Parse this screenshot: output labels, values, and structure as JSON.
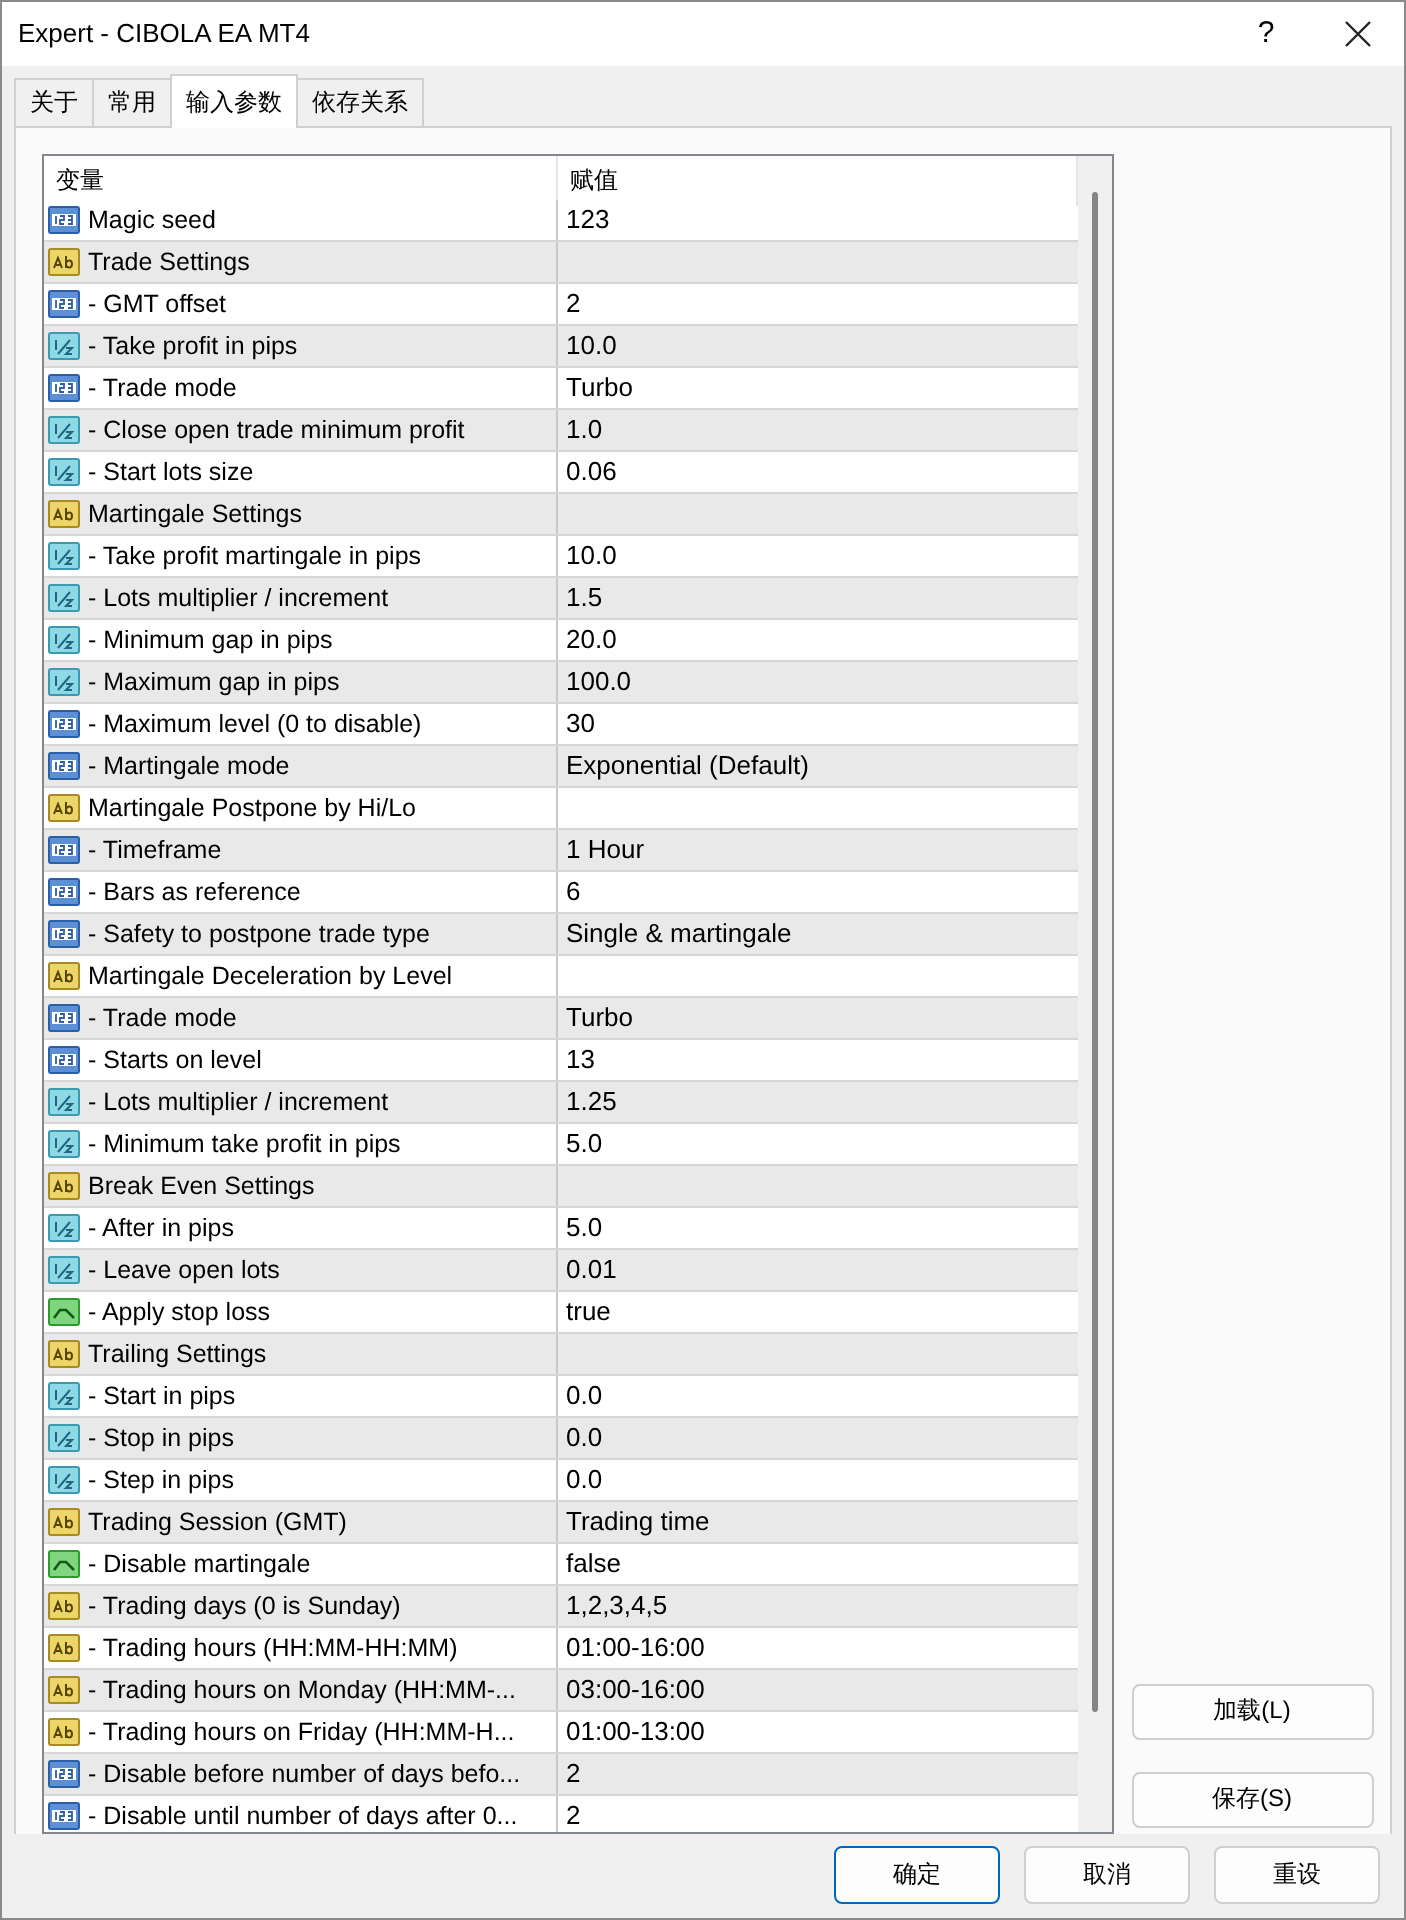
{
  "window": {
    "title": "Expert - CIBOLA EA MT4",
    "help": "?"
  },
  "tabs": [
    {
      "label": "关于",
      "selected": false
    },
    {
      "label": "常用",
      "selected": false
    },
    {
      "label": "输入参数",
      "selected": true
    },
    {
      "label": "依存关系",
      "selected": false
    }
  ],
  "table": {
    "columns": [
      "变量",
      "赋值"
    ],
    "rows": [
      {
        "kind": "int",
        "name": "Magic seed",
        "value": "123"
      },
      {
        "kind": "string",
        "name": "Trade Settings"
      },
      {
        "kind": "int",
        "name": "- GMT offset",
        "value": "2"
      },
      {
        "kind": "double",
        "name": "- Take profit in pips",
        "value": "10.0"
      },
      {
        "kind": "int",
        "name": "- Trade mode",
        "value": "Turbo"
      },
      {
        "kind": "double",
        "name": "- Close open trade minimum profit",
        "value": "1.0"
      },
      {
        "kind": "double",
        "name": "- Start lots size",
        "value": "0.06"
      },
      {
        "kind": "string",
        "name": "Martingale Settings"
      },
      {
        "kind": "double",
        "name": "- Take profit martingale in pips",
        "value": "10.0"
      },
      {
        "kind": "double",
        "name": "- Lots multiplier / increment",
        "value": "1.5"
      },
      {
        "kind": "double",
        "name": "- Minimum gap in pips",
        "value": "20.0"
      },
      {
        "kind": "double",
        "name": "- Maximum gap in pips",
        "value": "100.0"
      },
      {
        "kind": "int",
        "name": "- Maximum level (0 to disable)",
        "value": "30"
      },
      {
        "kind": "int",
        "name": "- Martingale mode",
        "value": "Exponential (Default)"
      },
      {
        "kind": "string",
        "name": "Martingale Postpone by Hi/Lo"
      },
      {
        "kind": "int",
        "name": "- Timeframe",
        "value": "1 Hour"
      },
      {
        "kind": "int",
        "name": "- Bars as reference",
        "value": "6"
      },
      {
        "kind": "int",
        "name": "- Safety to postpone trade type",
        "value": "Single & martingale"
      },
      {
        "kind": "string",
        "name": "Martingale Deceleration by Level"
      },
      {
        "kind": "int",
        "name": "- Trade mode",
        "value": "Turbo"
      },
      {
        "kind": "int",
        "name": "- Starts on level",
        "value": "13"
      },
      {
        "kind": "double",
        "name": "- Lots multiplier / increment",
        "value": "1.25"
      },
      {
        "kind": "double",
        "name": "- Minimum take profit in pips",
        "value": "5.0"
      },
      {
        "kind": "string",
        "name": "Break Even Settings"
      },
      {
        "kind": "double",
        "name": "- After in pips",
        "value": "5.0"
      },
      {
        "kind": "double",
        "name": "- Leave open lots",
        "value": "0.01"
      },
      {
        "kind": "bool",
        "name": "- Apply stop loss",
        "value": "true"
      },
      {
        "kind": "string",
        "name": "Trailing Settings"
      },
      {
        "kind": "double",
        "name": "- Start in pips",
        "value": "0.0"
      },
      {
        "kind": "double",
        "name": "- Stop in pips",
        "value": "0.0"
      },
      {
        "kind": "double",
        "name": "- Step in pips",
        "value": "0.0"
      },
      {
        "kind": "string",
        "name": "Trading Session (GMT)",
        "value": "Trading time"
      },
      {
        "kind": "bool",
        "name": "- Disable martingale",
        "value": "false"
      },
      {
        "kind": "string",
        "name": "- Trading days (0 is Sunday)",
        "value": "1,2,3,4,5"
      },
      {
        "kind": "string",
        "name": "- Trading hours (HH:MM-HH:MM)",
        "value": "01:00-16:00"
      },
      {
        "kind": "string",
        "name": "- Trading hours on Monday (HH:MM-...",
        "value": "03:00-16:00"
      },
      {
        "kind": "string",
        "name": "- Trading hours on Friday (HH:MM-H...",
        "value": "01:00-13:00"
      },
      {
        "kind": "int",
        "name": "- Disable before number of days befo...",
        "value": "2"
      },
      {
        "kind": "int",
        "name": "- Disable until number of days after 0...",
        "value": "2"
      }
    ]
  },
  "side_buttons": [
    "加载(L)",
    "保存(S)"
  ],
  "buttons": [
    {
      "label": "确定",
      "default": true
    },
    {
      "label": "取消",
      "default": false
    },
    {
      "label": "重设",
      "default": false
    }
  ]
}
